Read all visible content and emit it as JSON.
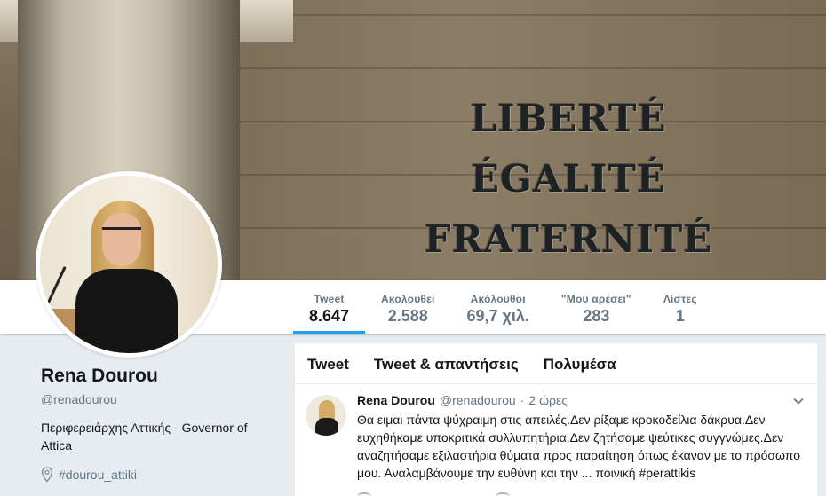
{
  "cover": {
    "motto": [
      "LIBERTÉ",
      "ÉGALITÉ",
      "FRATERNITÉ"
    ]
  },
  "stats": [
    {
      "label": "Tweet",
      "value": "8.647"
    },
    {
      "label": "Ακολουθεί",
      "value": "2.588"
    },
    {
      "label": "Ακόλουθοι",
      "value": "69,7 χιλ."
    },
    {
      "label": "\"Μου αρέσει\"",
      "value": "283"
    },
    {
      "label": "Λίστες",
      "value": "1"
    }
  ],
  "profile": {
    "name": "Rena Dourou",
    "handle": "@renadourou",
    "bio": "Περιφερειάρχης Αττικής - Governor of Attica",
    "location": "#dourou_attiki"
  },
  "timeline": {
    "tabs": [
      "Tweet",
      "Tweet & απαντήσεις",
      "Πολυμέσα"
    ],
    "tweet": {
      "name": "Rena Dourou",
      "handle": "@renadourou",
      "separator": "·",
      "time": "2 ώρες",
      "text": "Θα ειμαι πάντα ψύχραιμη στις απειλές.Δεν ρίξαμε κροκοδείλια δάκρυα.Δεν ευχηθήκαμε υποκριτικά συλλυπητήρια.Δεν ζητήσαμε ψεύτικες συγγνώμες.Δεν αναζητήσαμε εξιλαστήρια θύματα προς παραίτηση όπως έκαναν με το πρόσωπο μου. Αναλαμβάνουμε την ευθύνη και την ... ποινική #perattikis"
    }
  },
  "colors": {
    "accent": "#1da1f2",
    "secondary_text": "#657786",
    "background": "#e6ecf0"
  }
}
